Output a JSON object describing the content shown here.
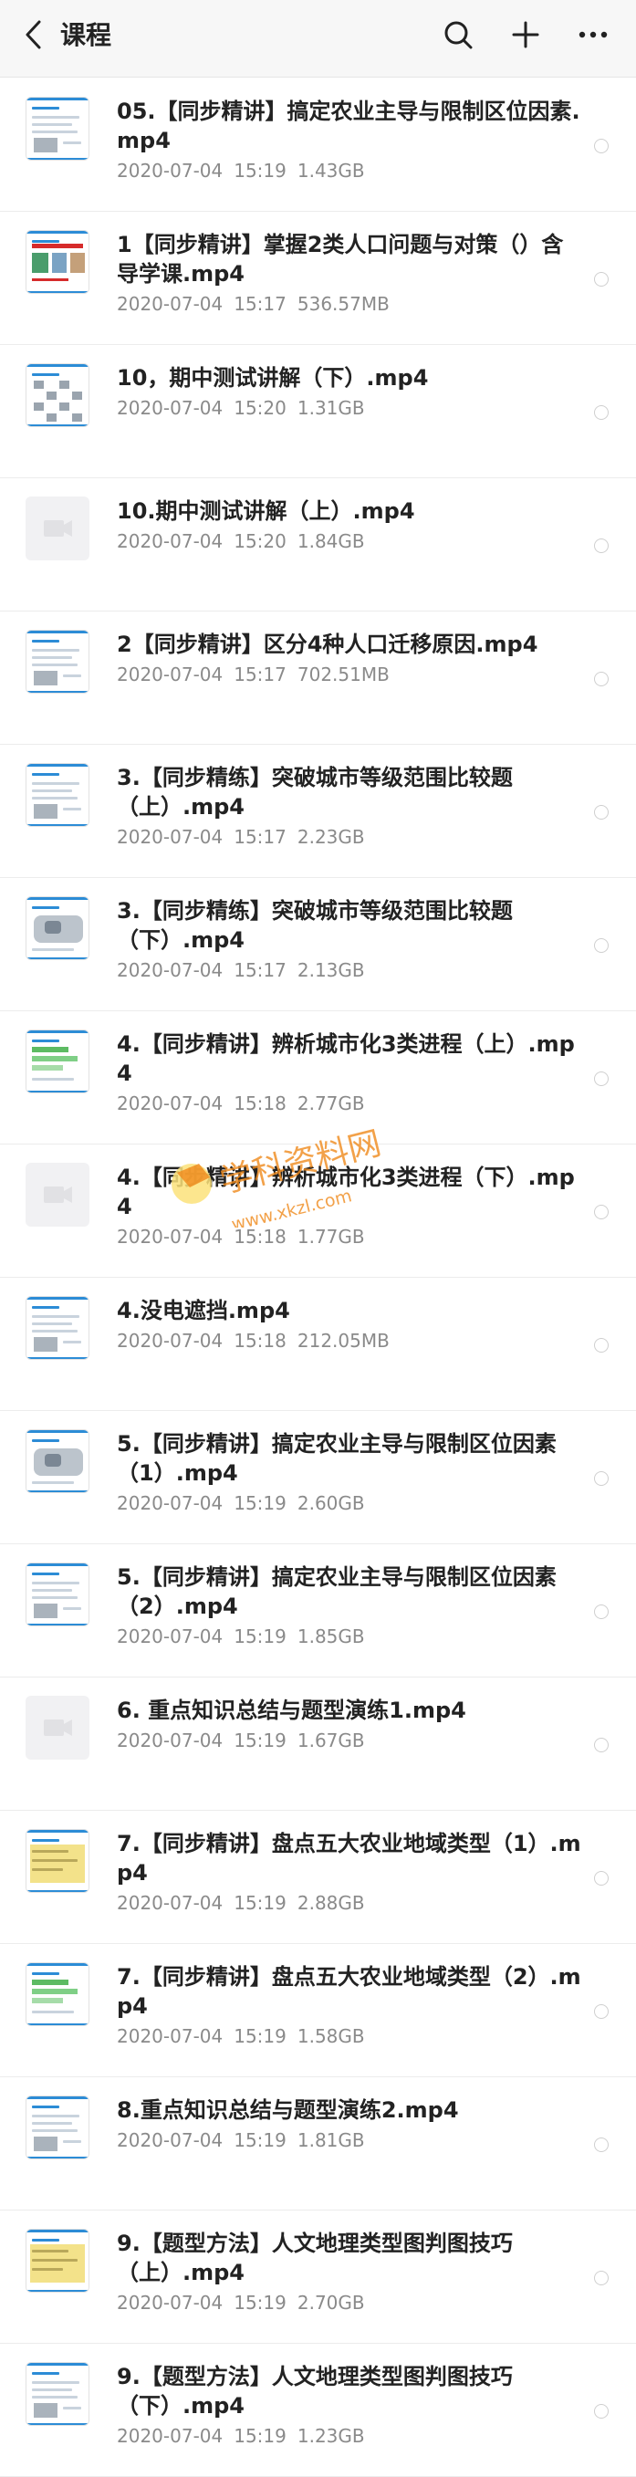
{
  "header": {
    "title": "课程"
  },
  "icons": {
    "back": "chevron-left-icon",
    "search": "search-icon",
    "add": "plus-icon",
    "more": "more-icon"
  },
  "colors": {
    "header_bg": "#f7f7f7",
    "meta_text": "#8a8a8a",
    "thumb_accent": "#2c8cd6",
    "watermark_orange": "#f08a1c"
  },
  "watermark": {
    "text_cn": "学科资料网",
    "text_url": "www.xkzl.com"
  },
  "files": [
    {
      "name": "05.【同步精讲】搞定农业主导与限制区位因素.mp4",
      "date": "2020-07-04",
      "time": "15:19",
      "size": "1.43GB",
      "thumb": "doc"
    },
    {
      "name": "1【同步精讲】掌握2类人口问题与对策（）含导学课.mp4",
      "date": "2020-07-04",
      "time": "15:17",
      "size": "536.57MB",
      "thumb": "doc-red"
    },
    {
      "name": "10，期中测试讲解（下）.mp4",
      "date": "2020-07-04",
      "time": "15:20",
      "size": "1.31GB",
      "thumb": "doc-grid"
    },
    {
      "name": "10.期中测试讲解（上）.mp4",
      "date": "2020-07-04",
      "time": "15:20",
      "size": "1.84GB",
      "thumb": "placeholder"
    },
    {
      "name": "2【同步精讲】区分4种人口迁移原因.mp4",
      "date": "2020-07-04",
      "time": "15:17",
      "size": "702.51MB",
      "thumb": "doc"
    },
    {
      "name": "3.【同步精练】突破城市等级范围比较题（上）.mp4",
      "date": "2020-07-04",
      "time": "15:17",
      "size": "2.23GB",
      "thumb": "doc"
    },
    {
      "name": "3.【同步精练】突破城市等级范围比较题（下）.mp4",
      "date": "2020-07-04",
      "time": "15:17",
      "size": "2.13GB",
      "thumb": "doc-map"
    },
    {
      "name": "4.【同步精讲】辨析城市化3类进程（上）.mp4",
      "date": "2020-07-04",
      "time": "15:18",
      "size": "2.77GB",
      "thumb": "doc-green"
    },
    {
      "name": "4.【同步精讲】辨析城市化3类进程（下）.mp4",
      "date": "2020-07-04",
      "time": "15:18",
      "size": "1.77GB",
      "thumb": "placeholder"
    },
    {
      "name": "4.没电遮挡.mp4",
      "date": "2020-07-04",
      "time": "15:18",
      "size": "212.05MB",
      "thumb": "doc"
    },
    {
      "name": "5.【同步精讲】搞定农业主导与限制区位因素（1）.mp4",
      "date": "2020-07-04",
      "time": "15:19",
      "size": "2.60GB",
      "thumb": "doc-map"
    },
    {
      "name": "5.【同步精讲】搞定农业主导与限制区位因素（2）.mp4",
      "date": "2020-07-04",
      "time": "15:19",
      "size": "1.85GB",
      "thumb": "doc"
    },
    {
      "name": "6. 重点知识总结与题型演练1.mp4",
      "date": "2020-07-04",
      "time": "15:19",
      "size": "1.67GB",
      "thumb": "placeholder"
    },
    {
      "name": "7.【同步精讲】盘点五大农业地域类型（1）.mp4",
      "date": "2020-07-04",
      "time": "15:19",
      "size": "2.88GB",
      "thumb": "doc-yellow"
    },
    {
      "name": "7.【同步精讲】盘点五大农业地域类型（2）.mp4",
      "date": "2020-07-04",
      "time": "15:19",
      "size": "1.58GB",
      "thumb": "doc-green"
    },
    {
      "name": "8.重点知识总结与题型演练2.mp4",
      "date": "2020-07-04",
      "time": "15:19",
      "size": "1.81GB",
      "thumb": "doc"
    },
    {
      "name": "9.【题型方法】人文地理类型图判图技巧（上）.mp4",
      "date": "2020-07-04",
      "time": "15:19",
      "size": "2.70GB",
      "thumb": "doc-yellow"
    },
    {
      "name": "9.【题型方法】人文地理类型图判图技巧（下）.mp4",
      "date": "2020-07-04",
      "time": "15:19",
      "size": "1.23GB",
      "thumb": "doc"
    }
  ]
}
